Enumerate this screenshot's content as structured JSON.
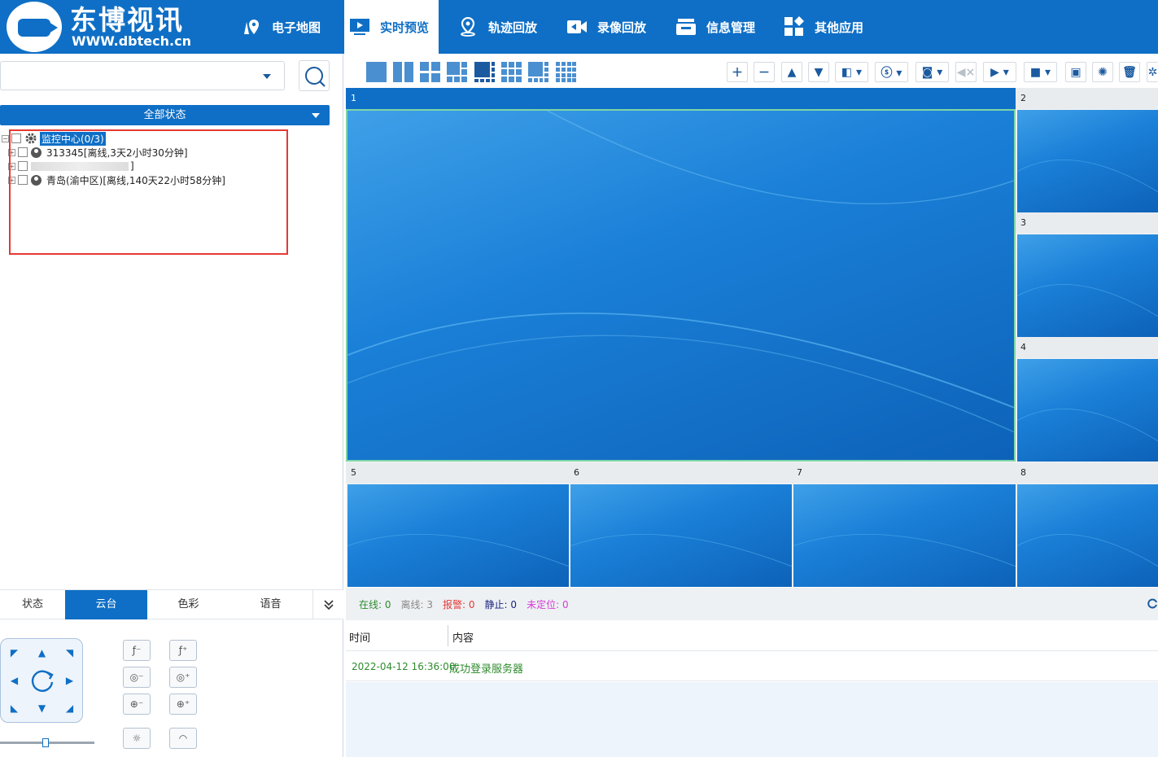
{
  "brand": {
    "name": "东博视讯",
    "url": "WWW.dbtech.cn"
  },
  "nav": [
    {
      "label": "电子地图",
      "icon": "map-pin-icon",
      "active": false
    },
    {
      "label": "实时预览",
      "icon": "play-screen-icon",
      "active": true
    },
    {
      "label": "轨迹回放",
      "icon": "location-icon",
      "active": false
    },
    {
      "label": "录像回放",
      "icon": "video-rewind-icon",
      "active": false
    },
    {
      "label": "信息管理",
      "icon": "info-box-icon",
      "active": false
    },
    {
      "label": "其他应用",
      "icon": "apps-icon",
      "active": false
    }
  ],
  "left": {
    "device_select_value": "",
    "status_filter": "全部状态",
    "tree": {
      "root": "监控中心(0/3)",
      "items": [
        {
          "label": "313345[离线,3天2小时30分钟]"
        },
        {
          "label": "]"
        },
        {
          "label": "青岛(渝中区)[离线,140天22小时58分钟]"
        }
      ]
    },
    "ctrl_tabs": [
      "状态",
      "云台",
      "色彩",
      "语音"
    ],
    "active_ctrl_tab": "云台",
    "ptz_speed_fraction": 0.48
  },
  "toolbar": {
    "layouts": [
      "1x1",
      "1x2",
      "2x2",
      "1+5",
      "1+7",
      "3x3",
      "1+8",
      "4x4"
    ]
  },
  "video_cells": [
    "1",
    "2",
    "3",
    "4",
    "5",
    "6",
    "7",
    "8"
  ],
  "statusbar": {
    "online_label": "在线:",
    "online": "0",
    "offline_label": "离线:",
    "offline": "3",
    "alarm_label": "报警:",
    "alarm": "0",
    "static_label": "静止:",
    "static": "0",
    "unloc_label": "未定位:",
    "unloc": "0"
  },
  "log": {
    "col_time": "时间",
    "col_content": "内容",
    "rows": [
      {
        "time": "2022-04-12 16:36:00",
        "content": "成功登录服务器"
      }
    ]
  },
  "colors": {
    "primary": "#0f6fc6",
    "online": "#2e8b2e",
    "alarm": "#e53935",
    "unloc": "#d63bd6"
  }
}
